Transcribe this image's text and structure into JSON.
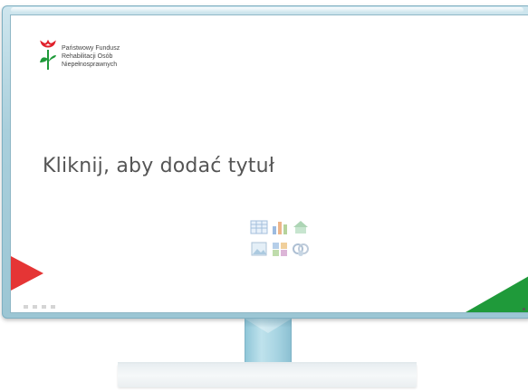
{
  "slide": {
    "title_placeholder": "Kliknij, aby dodać tytuł",
    "logo": {
      "lines": [
        "Państwowy Fundusz",
        "Rehabilitacji Osób",
        "Niepełnosprawnych"
      ]
    },
    "content_placeholder_icons": [
      "table-icon",
      "chart-icon",
      "smartart-icon",
      "picture-icon",
      "clipart-icon",
      "media-icon"
    ]
  },
  "colors": {
    "accent_red": "#e53535",
    "accent_green": "#1f9a3a",
    "bezel": "#a9cfdc"
  }
}
